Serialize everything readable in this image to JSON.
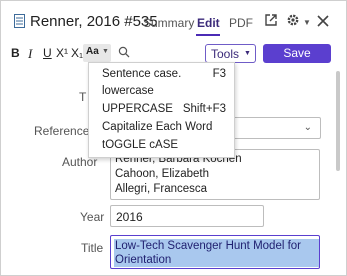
{
  "header": {
    "title": "Renner, 2016 #535",
    "tabs": [
      {
        "label": "Summary"
      },
      {
        "label": "Edit"
      },
      {
        "label": "PDF"
      }
    ],
    "active_tab": "Edit"
  },
  "toolbar": {
    "bold": "B",
    "italic": "I",
    "underline": "U",
    "superscript": "X¹",
    "subscript": "X₁",
    "case_button": "Aa",
    "tools_label": "Tools",
    "save_label": "Save"
  },
  "case_menu": {
    "items": [
      {
        "label": "Sentence case.",
        "shortcut": "F3"
      },
      {
        "label": "lowercase",
        "shortcut": ""
      },
      {
        "label": "UPPERCASE",
        "shortcut": "Shift+F3"
      },
      {
        "label": "Capitalize Each Word",
        "shortcut": ""
      },
      {
        "label": "tOGGLE cASE",
        "shortcut": ""
      }
    ]
  },
  "form": {
    "type_label": "T",
    "reference_type_label": "Reference T",
    "author_label": "Author",
    "authors": [
      "Renner, Barbara Kochen",
      "Cahoon, Elizabeth",
      "Allegri, Francesca"
    ],
    "year_label": "Year",
    "year_value": "2016",
    "title_label": "Title",
    "title_lines": [
      "Low-Tech Scavenger Hunt Model for Student",
      "Orientation"
    ]
  },
  "colors": {
    "accent": "#5b3fcf",
    "selection": "#a9c8ee"
  }
}
